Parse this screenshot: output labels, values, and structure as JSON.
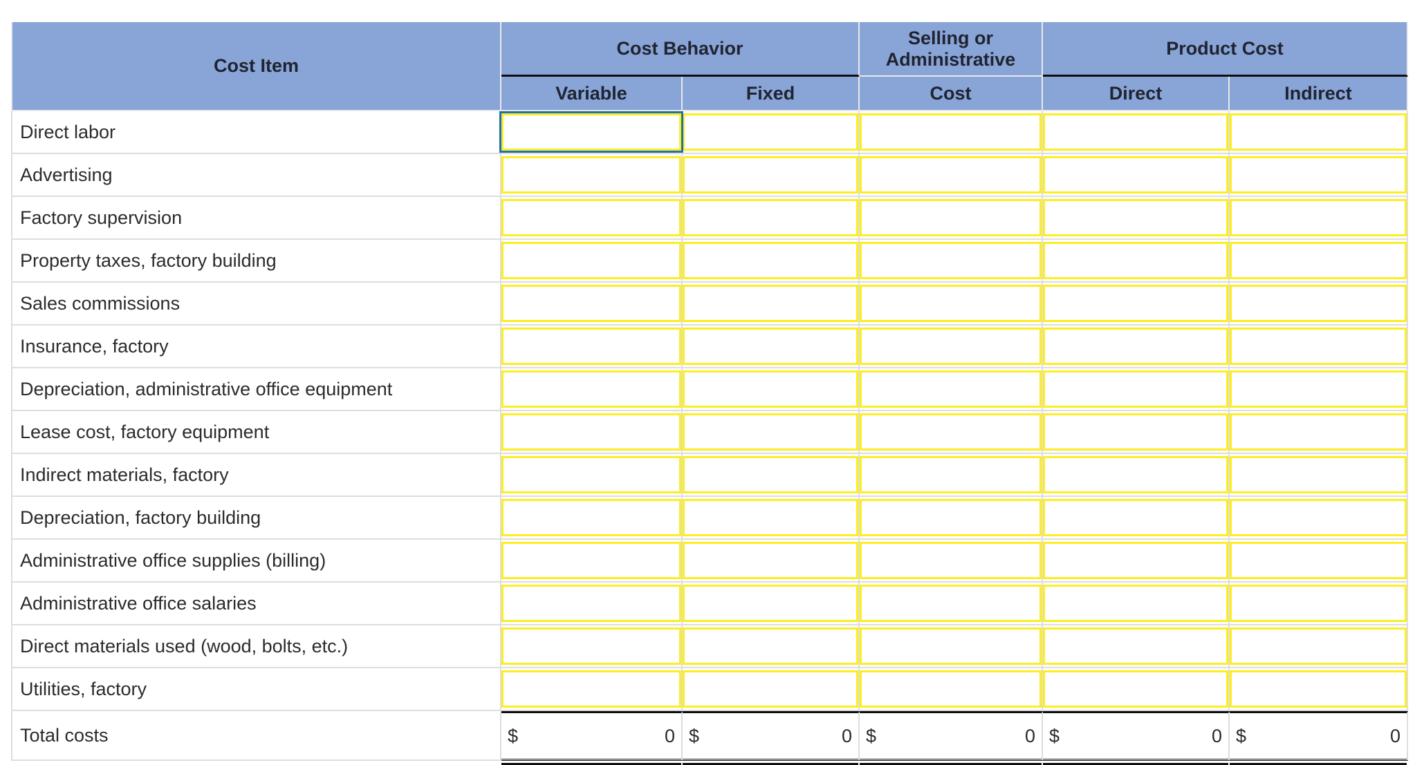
{
  "table": {
    "group_headers": {
      "blank": "",
      "cost_behavior": "Cost Behavior",
      "selling_or_administrative": "Selling or\nAdministrative",
      "selling_or_administrative_line1": "Selling or",
      "selling_or_administrative_line2": "Administrative",
      "product_cost": "Product Cost"
    },
    "column_headers": {
      "cost_item": "Cost Item",
      "variable": "Variable",
      "fixed": "Fixed",
      "cost": "Cost",
      "direct": "Direct",
      "indirect": "Indirect"
    },
    "rows": [
      {
        "label": "Direct labor",
        "variable": "",
        "fixed": "",
        "cost": "",
        "direct": "",
        "indirect": ""
      },
      {
        "label": "Advertising",
        "variable": "",
        "fixed": "",
        "cost": "",
        "direct": "",
        "indirect": ""
      },
      {
        "label": "Factory supervision",
        "variable": "",
        "fixed": "",
        "cost": "",
        "direct": "",
        "indirect": ""
      },
      {
        "label": "Property taxes, factory building",
        "variable": "",
        "fixed": "",
        "cost": "",
        "direct": "",
        "indirect": ""
      },
      {
        "label": "Sales commissions",
        "variable": "",
        "fixed": "",
        "cost": "",
        "direct": "",
        "indirect": ""
      },
      {
        "label": "Insurance, factory",
        "variable": "",
        "fixed": "",
        "cost": "",
        "direct": "",
        "indirect": ""
      },
      {
        "label": "Depreciation, administrative office equipment",
        "variable": "",
        "fixed": "",
        "cost": "",
        "direct": "",
        "indirect": ""
      },
      {
        "label": "Lease cost, factory equipment",
        "variable": "",
        "fixed": "",
        "cost": "",
        "direct": "",
        "indirect": ""
      },
      {
        "label": "Indirect materials, factory",
        "variable": "",
        "fixed": "",
        "cost": "",
        "direct": "",
        "indirect": ""
      },
      {
        "label": "Depreciation, factory building",
        "variable": "",
        "fixed": "",
        "cost": "",
        "direct": "",
        "indirect": ""
      },
      {
        "label": "Administrative office supplies (billing)",
        "variable": "",
        "fixed": "",
        "cost": "",
        "direct": "",
        "indirect": ""
      },
      {
        "label": "Administrative office salaries",
        "variable": "",
        "fixed": "",
        "cost": "",
        "direct": "",
        "indirect": ""
      },
      {
        "label": "Direct materials used (wood, bolts, etc.)",
        "variable": "",
        "fixed": "",
        "cost": "",
        "direct": "",
        "indirect": ""
      },
      {
        "label": "Utilities, factory",
        "variable": "",
        "fixed": "",
        "cost": "",
        "direct": "",
        "indirect": ""
      }
    ],
    "totals": {
      "label": "Total costs",
      "currency_symbol": "$",
      "variable": "0",
      "fixed": "0",
      "cost": "0",
      "direct": "0",
      "indirect": "0"
    },
    "selected_cell": {
      "row": 0,
      "column": "variable"
    }
  },
  "colors": {
    "header_fill": "#89a4d7",
    "header_text": "#1f2430",
    "cell_border": "#fcee21",
    "selection_border": "#1f6fb4",
    "grid_line": "#dddddd",
    "rule": "#0d0d0d",
    "body_text": "#2b2b2b"
  }
}
